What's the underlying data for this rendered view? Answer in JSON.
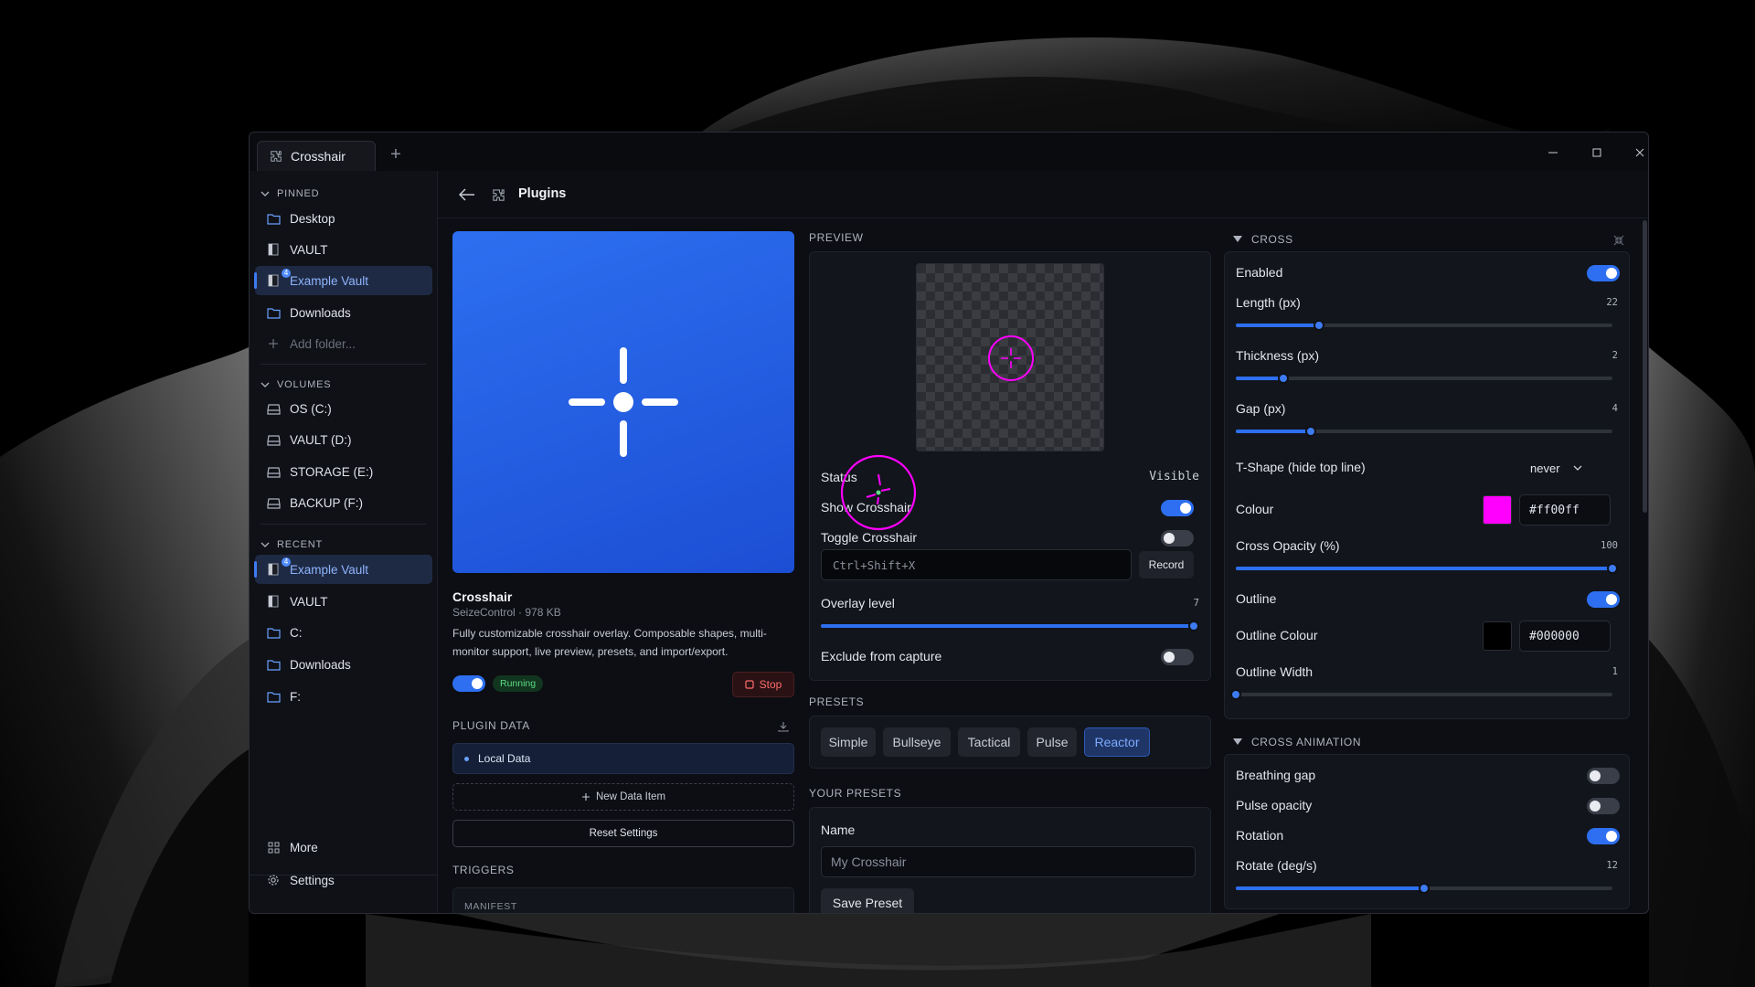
{
  "window": {
    "tab_title": "Crosshair",
    "new_tab": "+"
  },
  "sidebar": {
    "pinned_label": "PINNED",
    "pinned": [
      {
        "label": "Desktop",
        "icon": "folder-icon"
      },
      {
        "label": "VAULT",
        "icon": "vault-icon"
      },
      {
        "label": "Example Vault",
        "icon": "vault-icon",
        "badge": "4",
        "active": true
      },
      {
        "label": "Downloads",
        "icon": "folder-icon"
      },
      {
        "label": "Add folder...",
        "icon": "plus-icon"
      }
    ],
    "volumes_label": "VOLUMES",
    "volumes": [
      {
        "label": "OS (C:)"
      },
      {
        "label": "VAULT (D:)"
      },
      {
        "label": "STORAGE (E:)"
      },
      {
        "label": "BACKUP (F:)"
      }
    ],
    "recent_label": "RECENT",
    "recent": [
      {
        "label": "Example Vault",
        "icon": "vault-icon",
        "badge": "4",
        "active": true
      },
      {
        "label": "VAULT",
        "icon": "vault-icon"
      },
      {
        "label": "C:",
        "icon": "folder-icon"
      },
      {
        "label": "Downloads",
        "icon": "folder-icon"
      },
      {
        "label": "F:",
        "icon": "folder-icon"
      }
    ],
    "more_label": "More",
    "settings_label": "Settings"
  },
  "header": {
    "title": "Plugins"
  },
  "plugin": {
    "name": "Crosshair",
    "meta": "SeizeControl · 978 KB",
    "description": "Fully customizable crosshair overlay. Composable shapes, multi-monitor support, live preview, presets, and import/export.",
    "status": "Running",
    "enabled": true,
    "stop_label": "Stop",
    "data_label": "PLUGIN DATA",
    "local_data": "Local Data",
    "new_item": "New Data Item",
    "reset": "Reset Settings",
    "triggers_label": "TRIGGERS",
    "manifest_label": "MANIFEST"
  },
  "preview": {
    "label": "PREVIEW",
    "status_label": "Status",
    "status_value": "Visible",
    "show_label": "Show Crosshair",
    "show_on": true,
    "toggle_label": "Toggle Crosshair",
    "toggle_on": false,
    "shortcut": "Ctrl+Shift+X",
    "record_label": "Record",
    "overlay_label": "Overlay level",
    "overlay_value": 7,
    "overlay_max": 7,
    "exclude_label": "Exclude from capture",
    "exclude_on": false
  },
  "presets": {
    "label": "PRESETS",
    "items": [
      "Simple",
      "Bullseye",
      "Tactical",
      "Pulse",
      "Reactor"
    ],
    "active": "Reactor"
  },
  "your_presets": {
    "label": "YOUR PRESETS",
    "name_label": "Name",
    "name_placeholder": "My Crosshair",
    "save_label": "Save Preset"
  },
  "cross": {
    "label": "CROSS",
    "enabled_label": "Enabled",
    "enabled": true,
    "length_label": "Length (px)",
    "length": 22,
    "thickness_label": "Thickness (px)",
    "thickness": 2,
    "gap_label": "Gap (px)",
    "gap": 4,
    "tshape_label": "T-Shape (hide top line)",
    "tshape_value": "never",
    "colour_label": "Colour",
    "colour": "#ff00ff",
    "opacity_label": "Cross Opacity (%)",
    "opacity": 100,
    "outline_label": "Outline",
    "outline": true,
    "outline_colour_label": "Outline Colour",
    "outline_colour": "#000000",
    "outline_width_label": "Outline Width",
    "outline_width": 1
  },
  "animation": {
    "label": "CROSS ANIMATION",
    "breathing_label": "Breathing gap",
    "breathing": false,
    "pulse_label": "Pulse opacity",
    "pulse": false,
    "rotation_label": "Rotation",
    "rotation": true,
    "rotate_label": "Rotate (deg/s)",
    "rotate": 12
  },
  "colors": {
    "accent": "#2d6ff0",
    "running": "#5fdc84",
    "stop": "#ff6b6b",
    "magenta": "#ff00ff"
  }
}
